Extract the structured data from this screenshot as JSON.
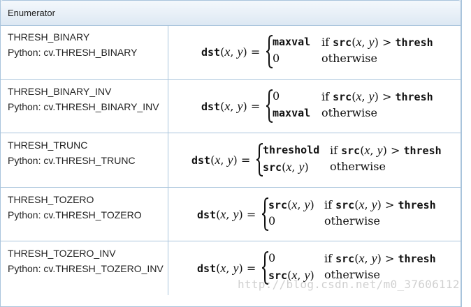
{
  "header": {
    "title": "Enumerator"
  },
  "rows": [
    {
      "name": "THRESH_BINARY",
      "python": "Python: cv.THRESH_BINARY",
      "cases": [
        {
          "value": "maxval",
          "value_type": "mono",
          "cond_fn": "src",
          "cond_tail": "thresh",
          "cond_type": "compare"
        },
        {
          "value": "0",
          "value_type": "number",
          "cond": "otherwise",
          "cond_type": "otherwise"
        }
      ]
    },
    {
      "name": "THRESH_BINARY_INV",
      "python": "Python: cv.THRESH_BINARY_INV",
      "cases": [
        {
          "value": "0",
          "value_type": "number",
          "cond_fn": "src",
          "cond_tail": "thresh",
          "cond_type": "compare"
        },
        {
          "value": "maxval",
          "value_type": "mono",
          "cond": "otherwise",
          "cond_type": "otherwise"
        }
      ]
    },
    {
      "name": "THRESH_TRUNC",
      "python": "Python: cv.THRESH_TRUNC",
      "cases": [
        {
          "value": "threshold",
          "value_type": "mono",
          "cond_fn": "src",
          "cond_tail": "thresh",
          "cond_type": "compare"
        },
        {
          "value": "src",
          "value_type": "fn",
          "cond": "otherwise",
          "cond_type": "otherwise"
        }
      ]
    },
    {
      "name": "THRESH_TOZERO",
      "python": "Python: cv.THRESH_TOZERO",
      "cases": [
        {
          "value": "src",
          "value_type": "fn",
          "cond_fn": "src",
          "cond_tail": "thresh",
          "cond_type": "compare"
        },
        {
          "value": "0",
          "value_type": "number",
          "cond": "otherwise",
          "cond_type": "otherwise"
        }
      ]
    },
    {
      "name": "THRESH_TOZERO_INV",
      "python": "Python: cv.THRESH_TOZERO_INV",
      "cases": [
        {
          "value": "0",
          "value_type": "number",
          "cond_fn": "src",
          "cond_tail": "thresh",
          "cond_type": "compare"
        },
        {
          "value": "src",
          "value_type": "fn",
          "cond": "otherwise",
          "cond_type": "otherwise"
        }
      ]
    }
  ],
  "formula": {
    "lhs_fn": "dst",
    "var_x": "x",
    "var_y": "y"
  },
  "watermark": "http://blog.csdn.net/m0_37606112"
}
